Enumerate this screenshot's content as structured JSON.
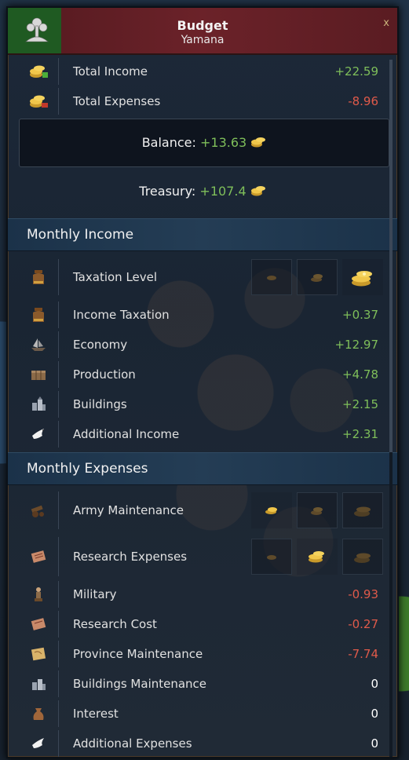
{
  "header": {
    "title": "Budget",
    "subtitle": "Yamana",
    "close_label": "x"
  },
  "summary": {
    "total_income": {
      "label": "Total Income",
      "value": "+22.59"
    },
    "total_expenses": {
      "label": "Total Expenses",
      "value": "-8.96"
    },
    "balance": {
      "label": "Balance:",
      "value": "+13.63"
    },
    "treasury": {
      "label": "Treasury:",
      "value": "+107.4"
    }
  },
  "monthly_income": {
    "title": "Monthly Income",
    "taxation_level": {
      "label": "Taxation Level",
      "levels": 3,
      "selected": 3
    },
    "rows": [
      {
        "label": "Income Taxation",
        "value": "+0.37",
        "icon": "money-bag-icon"
      },
      {
        "label": "Economy",
        "value": "+12.97",
        "icon": "ship-icon"
      },
      {
        "label": "Production",
        "value": "+4.78",
        "icon": "crate-icon"
      },
      {
        "label": "Buildings",
        "value": "+2.15",
        "icon": "buildings-icon"
      },
      {
        "label": "Additional Income",
        "value": "+2.31",
        "icon": "dove-icon"
      }
    ]
  },
  "monthly_expenses": {
    "title": "Monthly Expenses",
    "army_maintenance": {
      "label": "Army Maintenance",
      "levels": 3,
      "selected": 1
    },
    "research_expenses": {
      "label": "Research Expenses",
      "levels": 3,
      "selected": 2
    },
    "rows": [
      {
        "label": "Military",
        "value": "-0.93",
        "icon": "soldier-icon"
      },
      {
        "label": "Research Cost",
        "value": "-0.27",
        "icon": "scroll-icon"
      },
      {
        "label": "Province Maintenance",
        "value": "-7.74",
        "icon": "map-icon"
      },
      {
        "label": "Buildings Maintenance",
        "value": "0",
        "icon": "buildings-icon"
      },
      {
        "label": "Interest",
        "value": "0",
        "icon": "sack-icon"
      },
      {
        "label": "Additional Expenses",
        "value": "0",
        "icon": "dove-icon"
      }
    ]
  },
  "colors": {
    "positive": "#7fbf5a",
    "negative": "#e05a4a",
    "header_red": "#6b2229",
    "header_green": "#1f5a22"
  }
}
